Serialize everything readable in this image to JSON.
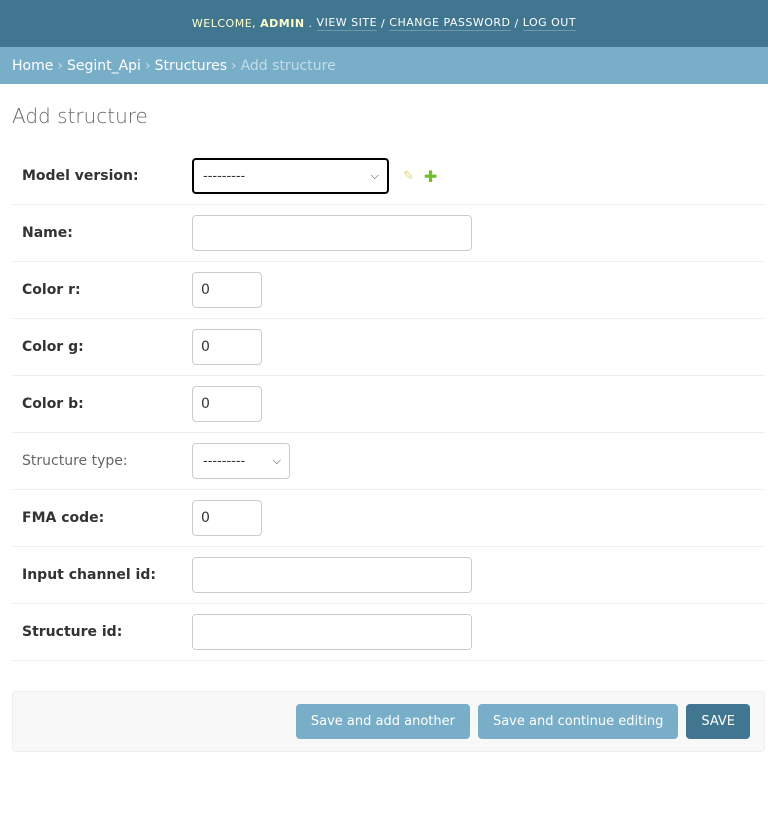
{
  "header": {
    "welcome": "WELCOME,",
    "username": "ADMIN",
    "period": ".",
    "view_site": "VIEW SITE",
    "change_password": "CHANGE PASSWORD",
    "log_out": "LOG OUT",
    "separator": "/"
  },
  "breadcrumbs": {
    "home": "Home",
    "app": "Segint_Api",
    "model": "Structures",
    "current": "Add structure",
    "arrow": "›"
  },
  "page": {
    "title": "Add structure"
  },
  "form": {
    "model_version": {
      "label": "Model version:",
      "value": "---------"
    },
    "name": {
      "label": "Name:",
      "value": ""
    },
    "color_r": {
      "label": "Color r:",
      "value": "0"
    },
    "color_g": {
      "label": "Color g:",
      "value": "0"
    },
    "color_b": {
      "label": "Color b:",
      "value": "0"
    },
    "structure_type": {
      "label": "Structure type:",
      "value": "---------"
    },
    "fma_code": {
      "label": "FMA code:",
      "value": "0"
    },
    "input_channel_id": {
      "label": "Input channel id:",
      "value": ""
    },
    "structure_id": {
      "label": "Structure id:",
      "value": ""
    }
  },
  "icons": {
    "edit": "pencil-icon",
    "add": "plus-icon",
    "dropdown": "chevron-down-icon"
  },
  "buttons": {
    "save_add_another": "Save and add another",
    "save_continue": "Save and continue editing",
    "save": "SAVE"
  },
  "colors": {
    "header": "#417690",
    "breadcrumbs": "#79aec8",
    "primary_button": "#417690",
    "secondary_button": "#79aec8"
  }
}
